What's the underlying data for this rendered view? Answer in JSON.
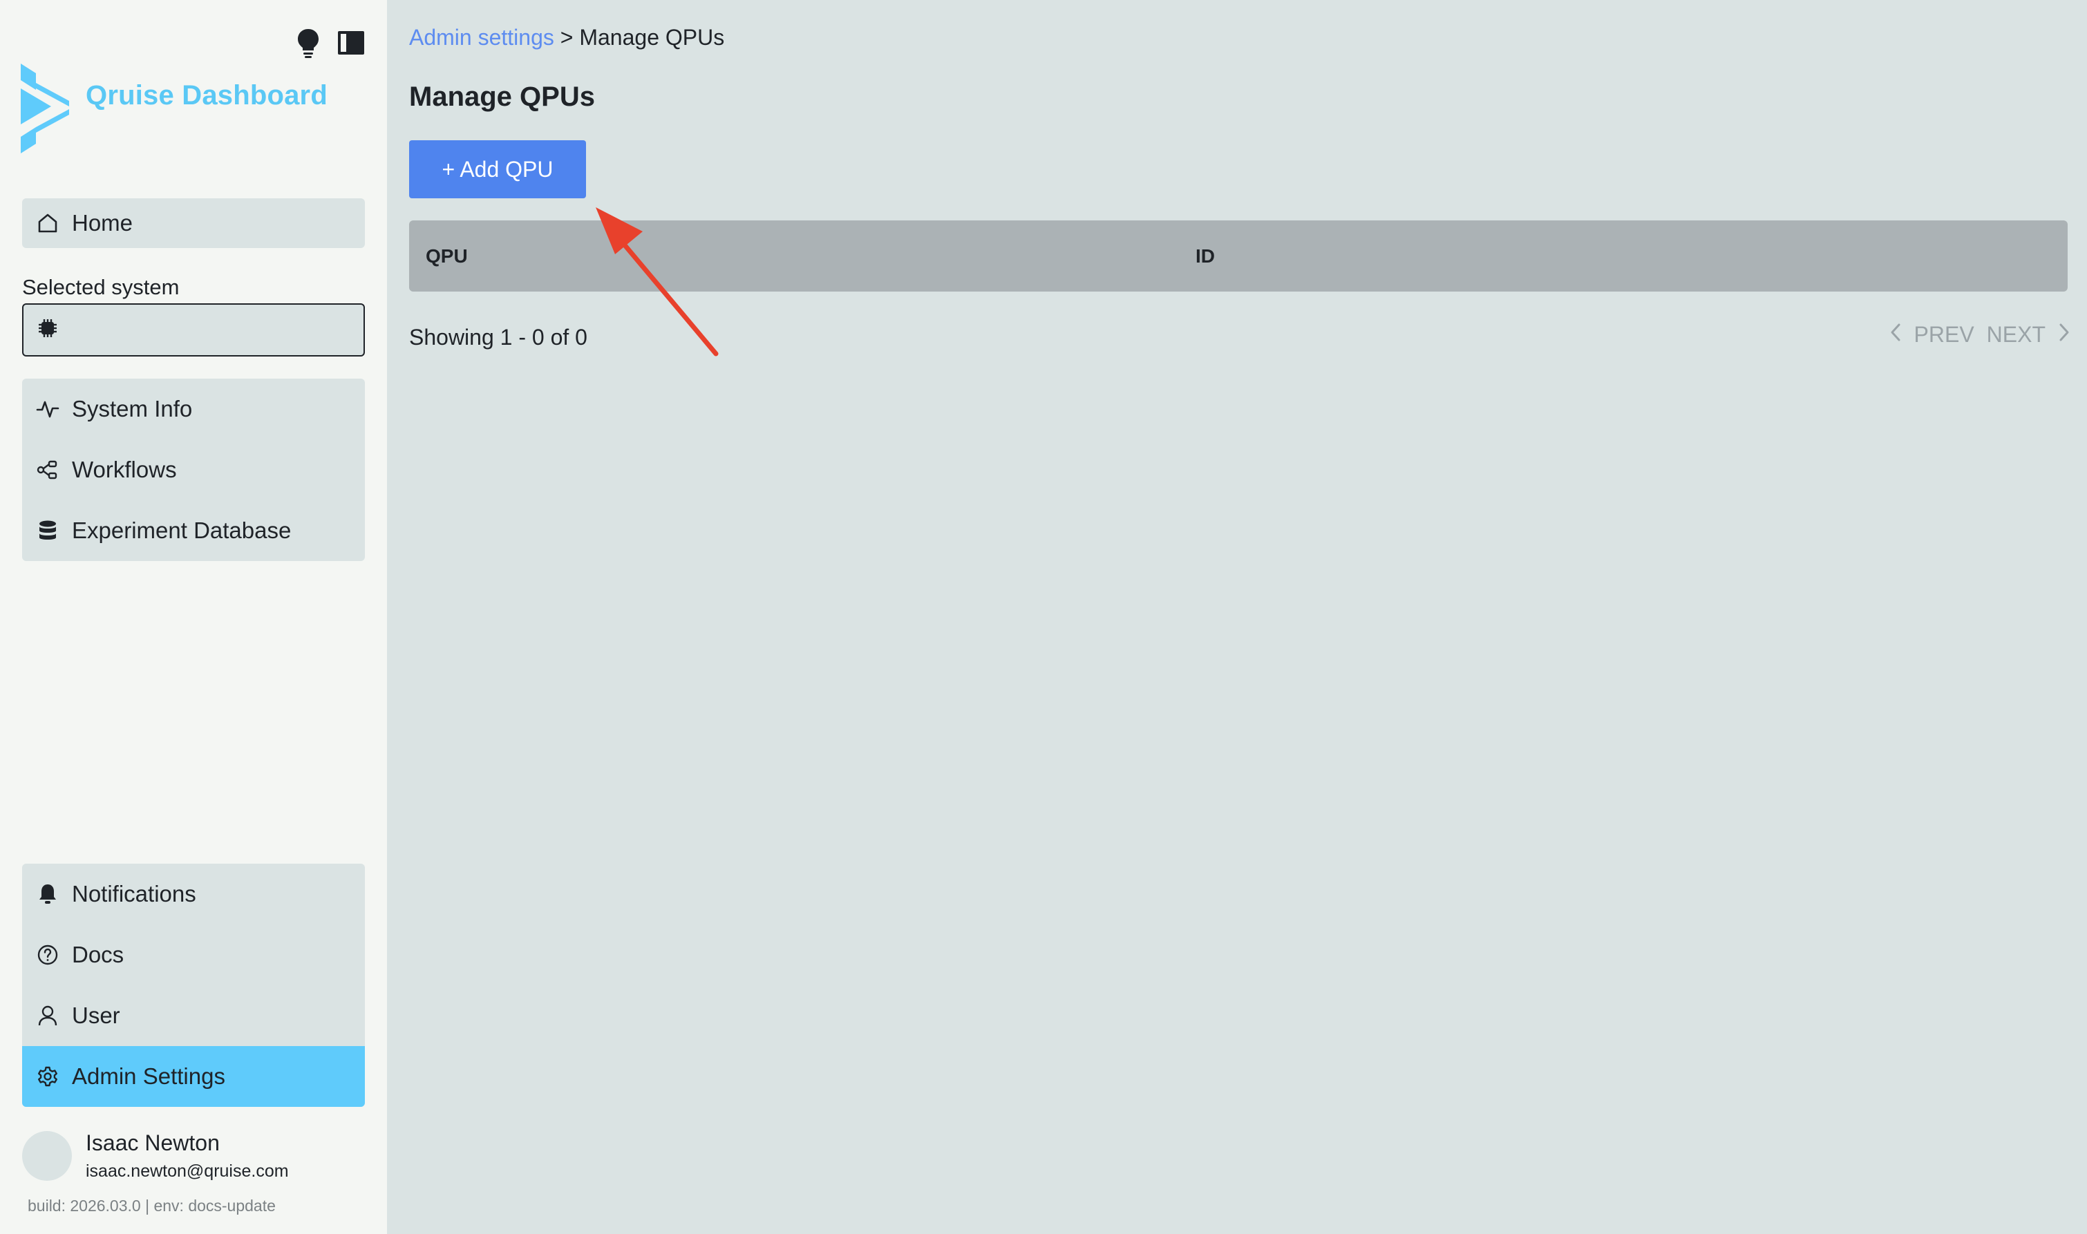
{
  "app": {
    "brand_name": "Qruise Dashboard",
    "accent_color": "#5fcbfb",
    "primary_button_color": "#4f84ee",
    "annotation_arrow_color": "#e8412c"
  },
  "sidebar": {
    "top_icons": [
      "lightbulb-icon",
      "sidebar-toggle-icon"
    ],
    "home": {
      "label": "Home",
      "icon": "home-icon"
    },
    "selected_system": {
      "label": "Selected system",
      "value": "",
      "icon": "chip-icon"
    },
    "main_nav": [
      {
        "label": "System Info",
        "icon": "activity-icon"
      },
      {
        "label": "Workflows",
        "icon": "workflow-icon"
      },
      {
        "label": "Experiment Database",
        "icon": "database-icon"
      }
    ],
    "bottom_nav": [
      {
        "label": "Notifications",
        "icon": "bell-icon",
        "active": false
      },
      {
        "label": "Docs",
        "icon": "help-circle-icon",
        "active": false
      },
      {
        "label": "User",
        "icon": "user-icon",
        "active": false
      },
      {
        "label": "Admin Settings",
        "icon": "gear-icon",
        "active": true
      }
    ],
    "user": {
      "name": "Isaac Newton",
      "email": "isaac.newton@qruise.com"
    },
    "build_info": "build: 2026.03.0 | env: docs-update"
  },
  "main": {
    "breadcrumb": {
      "link": "Admin settings",
      "separator": " > ",
      "current": "Manage QPUs"
    },
    "title": "Manage QPUs",
    "add_button_label": "+ Add QPU",
    "table": {
      "columns": [
        "QPU",
        "ID"
      ],
      "rows": []
    },
    "pagination": {
      "showing": "Showing 1 - 0 of 0",
      "prev_label": "PREV",
      "next_label": "NEXT"
    }
  }
}
